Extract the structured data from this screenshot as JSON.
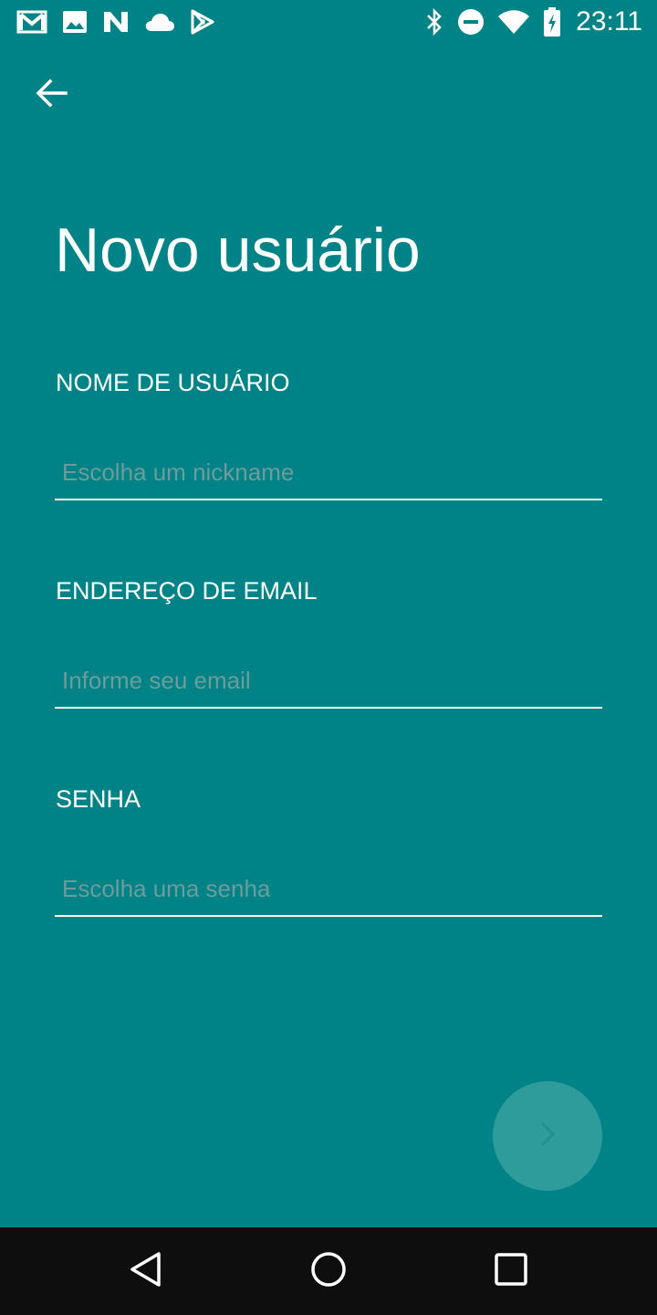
{
  "status_bar": {
    "time": "23:11",
    "left_icons": [
      "gmail-icon",
      "image-icon",
      "n-app-icon",
      "cloud-icon",
      "play-store-icon"
    ],
    "right_icons": [
      "bluetooth-icon",
      "do-not-disturb-icon",
      "wifi-icon",
      "battery-charging-icon"
    ]
  },
  "header": {
    "title": "Novo usuário"
  },
  "form": {
    "username": {
      "label": "NOME DE USUÁRIO",
      "placeholder": "Escolha um nickname",
      "value": ""
    },
    "email": {
      "label": "ENDEREÇO DE EMAIL",
      "placeholder": "Informe seu email",
      "value": ""
    },
    "password": {
      "label": "SENHA",
      "placeholder": "Escolha uma senha",
      "value": ""
    }
  },
  "actions": {
    "next_icon": "chevron-right-icon",
    "enabled": false
  },
  "nav_bar": {
    "icons": [
      "back-triangle-icon",
      "home-circle-icon",
      "recents-square-icon"
    ]
  },
  "colors": {
    "background": "#008386",
    "fab": "#2e9c9b",
    "placeholder": "#6c9c9c",
    "nav_bar": "#0e0e0e"
  }
}
